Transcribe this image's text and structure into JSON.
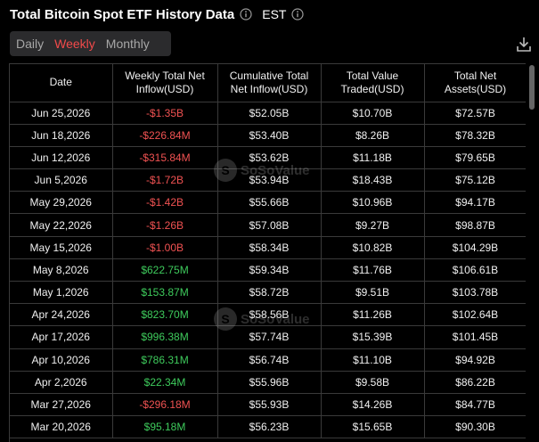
{
  "header": {
    "title": "Total Bitcoin Spot ETF History Data",
    "timezone": "EST"
  },
  "tabs": [
    {
      "label": "Daily",
      "active": false
    },
    {
      "label": "Weekly",
      "active": true
    },
    {
      "label": "Monthly",
      "active": false
    }
  ],
  "table": {
    "headers": [
      "Date",
      "Weekly Total Net Inflow(USD)",
      "Cumulative Total Net Inflow(USD)",
      "Total Value Traded(USD)",
      "Total Net Assets(USD)"
    ],
    "rows": [
      [
        "Jun 25,2026",
        "-$1.35B",
        "$52.05B",
        "$10.70B",
        "$72.57B"
      ],
      [
        "Jun 18,2026",
        "-$226.84M",
        "$53.40B",
        "$8.26B",
        "$78.32B"
      ],
      [
        "Jun 12,2026",
        "-$315.84M",
        "$53.62B",
        "$11.18B",
        "$79.65B"
      ],
      [
        "Jun 5,2026",
        "-$1.72B",
        "$53.94B",
        "$18.43B",
        "$75.12B"
      ],
      [
        "May 29,2026",
        "-$1.42B",
        "$55.66B",
        "$10.96B",
        "$94.17B"
      ],
      [
        "May 22,2026",
        "-$1.26B",
        "$57.08B",
        "$9.27B",
        "$98.87B"
      ],
      [
        "May 15,2026",
        "-$1.00B",
        "$58.34B",
        "$10.82B",
        "$104.29B"
      ],
      [
        "May 8,2026",
        "$622.75M",
        "$59.34B",
        "$11.76B",
        "$106.61B"
      ],
      [
        "May 1,2026",
        "$153.87M",
        "$58.72B",
        "$9.51B",
        "$103.78B"
      ],
      [
        "Apr 24,2026",
        "$823.70M",
        "$58.56B",
        "$11.26B",
        "$102.64B"
      ],
      [
        "Apr 17,2026",
        "$996.38M",
        "$57.74B",
        "$15.39B",
        "$101.45B"
      ],
      [
        "Apr 10,2026",
        "$786.31M",
        "$56.74B",
        "$11.10B",
        "$94.92B"
      ],
      [
        "Apr 2,2026",
        "$22.34M",
        "$55.96B",
        "$9.58B",
        "$86.22B"
      ],
      [
        "Mar 27,2026",
        "-$296.18M",
        "$55.93B",
        "$14.26B",
        "$84.77B"
      ],
      [
        "Mar 20,2026",
        "$95.18M",
        "$56.23B",
        "$15.65B",
        "$90.30B"
      ]
    ]
  },
  "watermark": {
    "text": "SoSoValue"
  },
  "colors": {
    "negative": "#f05252",
    "positive": "#3ecb5c",
    "active_tab": "#f24a4a"
  },
  "icons": {
    "info": "info-circle-icon",
    "download": "download-icon"
  }
}
